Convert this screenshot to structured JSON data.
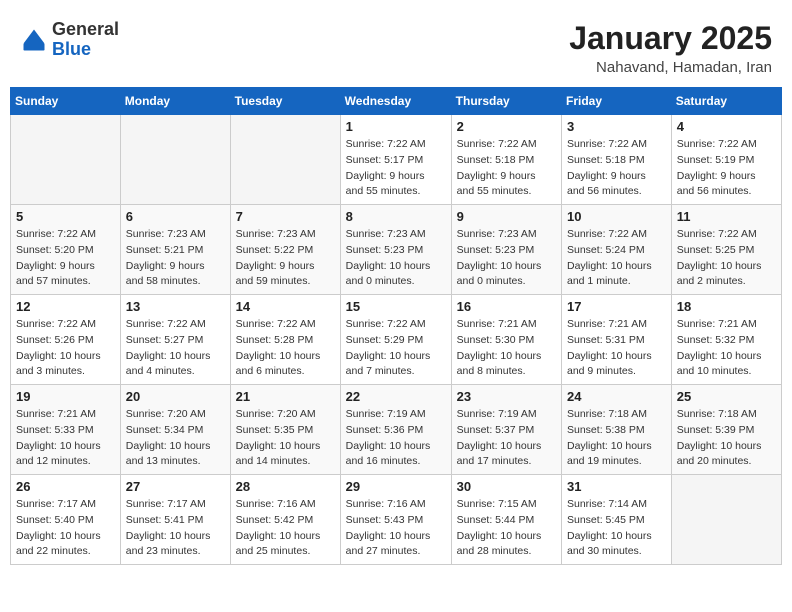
{
  "header": {
    "logo": {
      "general": "General",
      "blue": "Blue"
    },
    "title": "January 2025",
    "subtitle": "Nahavand, Hamadan, Iran"
  },
  "weekdays": [
    "Sunday",
    "Monday",
    "Tuesday",
    "Wednesday",
    "Thursday",
    "Friday",
    "Saturday"
  ],
  "weeks": [
    [
      {
        "day": "",
        "info": ""
      },
      {
        "day": "",
        "info": ""
      },
      {
        "day": "",
        "info": ""
      },
      {
        "day": "1",
        "info": "Sunrise: 7:22 AM\nSunset: 5:17 PM\nDaylight: 9 hours\nand 55 minutes."
      },
      {
        "day": "2",
        "info": "Sunrise: 7:22 AM\nSunset: 5:18 PM\nDaylight: 9 hours\nand 55 minutes."
      },
      {
        "day": "3",
        "info": "Sunrise: 7:22 AM\nSunset: 5:18 PM\nDaylight: 9 hours\nand 56 minutes."
      },
      {
        "day": "4",
        "info": "Sunrise: 7:22 AM\nSunset: 5:19 PM\nDaylight: 9 hours\nand 56 minutes."
      }
    ],
    [
      {
        "day": "5",
        "info": "Sunrise: 7:22 AM\nSunset: 5:20 PM\nDaylight: 9 hours\nand 57 minutes."
      },
      {
        "day": "6",
        "info": "Sunrise: 7:23 AM\nSunset: 5:21 PM\nDaylight: 9 hours\nand 58 minutes."
      },
      {
        "day": "7",
        "info": "Sunrise: 7:23 AM\nSunset: 5:22 PM\nDaylight: 9 hours\nand 59 minutes."
      },
      {
        "day": "8",
        "info": "Sunrise: 7:23 AM\nSunset: 5:23 PM\nDaylight: 10 hours\nand 0 minutes."
      },
      {
        "day": "9",
        "info": "Sunrise: 7:23 AM\nSunset: 5:23 PM\nDaylight: 10 hours\nand 0 minutes."
      },
      {
        "day": "10",
        "info": "Sunrise: 7:22 AM\nSunset: 5:24 PM\nDaylight: 10 hours\nand 1 minute."
      },
      {
        "day": "11",
        "info": "Sunrise: 7:22 AM\nSunset: 5:25 PM\nDaylight: 10 hours\nand 2 minutes."
      }
    ],
    [
      {
        "day": "12",
        "info": "Sunrise: 7:22 AM\nSunset: 5:26 PM\nDaylight: 10 hours\nand 3 minutes."
      },
      {
        "day": "13",
        "info": "Sunrise: 7:22 AM\nSunset: 5:27 PM\nDaylight: 10 hours\nand 4 minutes."
      },
      {
        "day": "14",
        "info": "Sunrise: 7:22 AM\nSunset: 5:28 PM\nDaylight: 10 hours\nand 6 minutes."
      },
      {
        "day": "15",
        "info": "Sunrise: 7:22 AM\nSunset: 5:29 PM\nDaylight: 10 hours\nand 7 minutes."
      },
      {
        "day": "16",
        "info": "Sunrise: 7:21 AM\nSunset: 5:30 PM\nDaylight: 10 hours\nand 8 minutes."
      },
      {
        "day": "17",
        "info": "Sunrise: 7:21 AM\nSunset: 5:31 PM\nDaylight: 10 hours\nand 9 minutes."
      },
      {
        "day": "18",
        "info": "Sunrise: 7:21 AM\nSunset: 5:32 PM\nDaylight: 10 hours\nand 10 minutes."
      }
    ],
    [
      {
        "day": "19",
        "info": "Sunrise: 7:21 AM\nSunset: 5:33 PM\nDaylight: 10 hours\nand 12 minutes."
      },
      {
        "day": "20",
        "info": "Sunrise: 7:20 AM\nSunset: 5:34 PM\nDaylight: 10 hours\nand 13 minutes."
      },
      {
        "day": "21",
        "info": "Sunrise: 7:20 AM\nSunset: 5:35 PM\nDaylight: 10 hours\nand 14 minutes."
      },
      {
        "day": "22",
        "info": "Sunrise: 7:19 AM\nSunset: 5:36 PM\nDaylight: 10 hours\nand 16 minutes."
      },
      {
        "day": "23",
        "info": "Sunrise: 7:19 AM\nSunset: 5:37 PM\nDaylight: 10 hours\nand 17 minutes."
      },
      {
        "day": "24",
        "info": "Sunrise: 7:18 AM\nSunset: 5:38 PM\nDaylight: 10 hours\nand 19 minutes."
      },
      {
        "day": "25",
        "info": "Sunrise: 7:18 AM\nSunset: 5:39 PM\nDaylight: 10 hours\nand 20 minutes."
      }
    ],
    [
      {
        "day": "26",
        "info": "Sunrise: 7:17 AM\nSunset: 5:40 PM\nDaylight: 10 hours\nand 22 minutes."
      },
      {
        "day": "27",
        "info": "Sunrise: 7:17 AM\nSunset: 5:41 PM\nDaylight: 10 hours\nand 23 minutes."
      },
      {
        "day": "28",
        "info": "Sunrise: 7:16 AM\nSunset: 5:42 PM\nDaylight: 10 hours\nand 25 minutes."
      },
      {
        "day": "29",
        "info": "Sunrise: 7:16 AM\nSunset: 5:43 PM\nDaylight: 10 hours\nand 27 minutes."
      },
      {
        "day": "30",
        "info": "Sunrise: 7:15 AM\nSunset: 5:44 PM\nDaylight: 10 hours\nand 28 minutes."
      },
      {
        "day": "31",
        "info": "Sunrise: 7:14 AM\nSunset: 5:45 PM\nDaylight: 10 hours\nand 30 minutes."
      },
      {
        "day": "",
        "info": ""
      }
    ]
  ]
}
